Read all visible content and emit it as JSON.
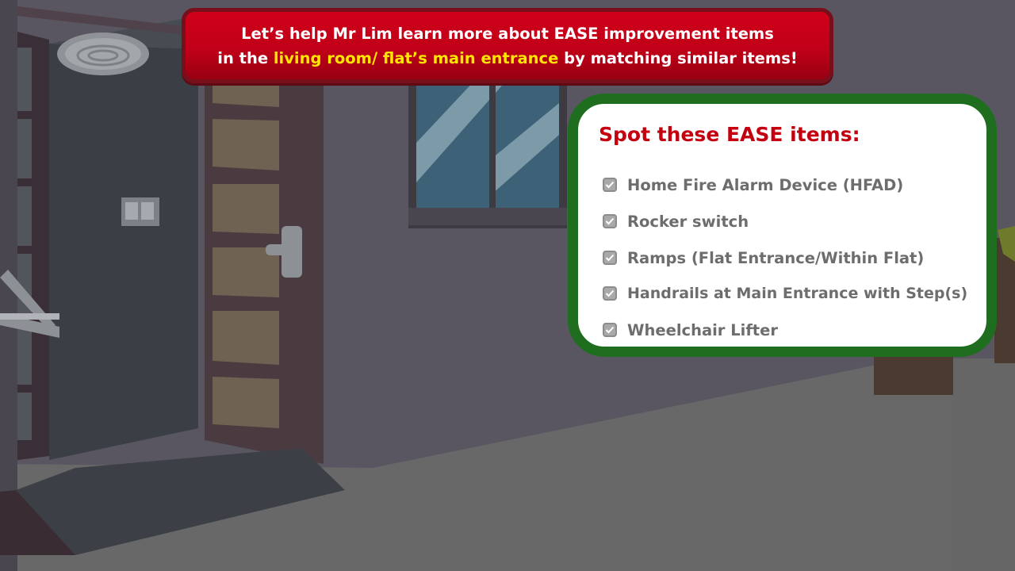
{
  "banner": {
    "line1": "Let’s help Mr Lim learn more about EASE improvement items",
    "line2_prefix": "in the ",
    "line2_highlight": "living room/ flat’s main entrance",
    "line2_suffix": " by matching similar items!",
    "highlight_color": "#ffe600",
    "background_color": "#c4001a"
  },
  "checklist": {
    "title": "Spot these EASE items:",
    "title_color": "#c40010",
    "border_color": "#1f6e1f",
    "items": [
      {
        "label": "Home Fire Alarm Device (HFAD)",
        "checked": true
      },
      {
        "label": "Rocker switch",
        "checked": true
      },
      {
        "label": "Ramps (Flat Entrance/Within Flat)",
        "checked": true
      },
      {
        "label": "Handrails at Main Entrance with Step(s)",
        "checked": true
      },
      {
        "label": "Wheelchair Lifter",
        "checked": true
      }
    ]
  }
}
